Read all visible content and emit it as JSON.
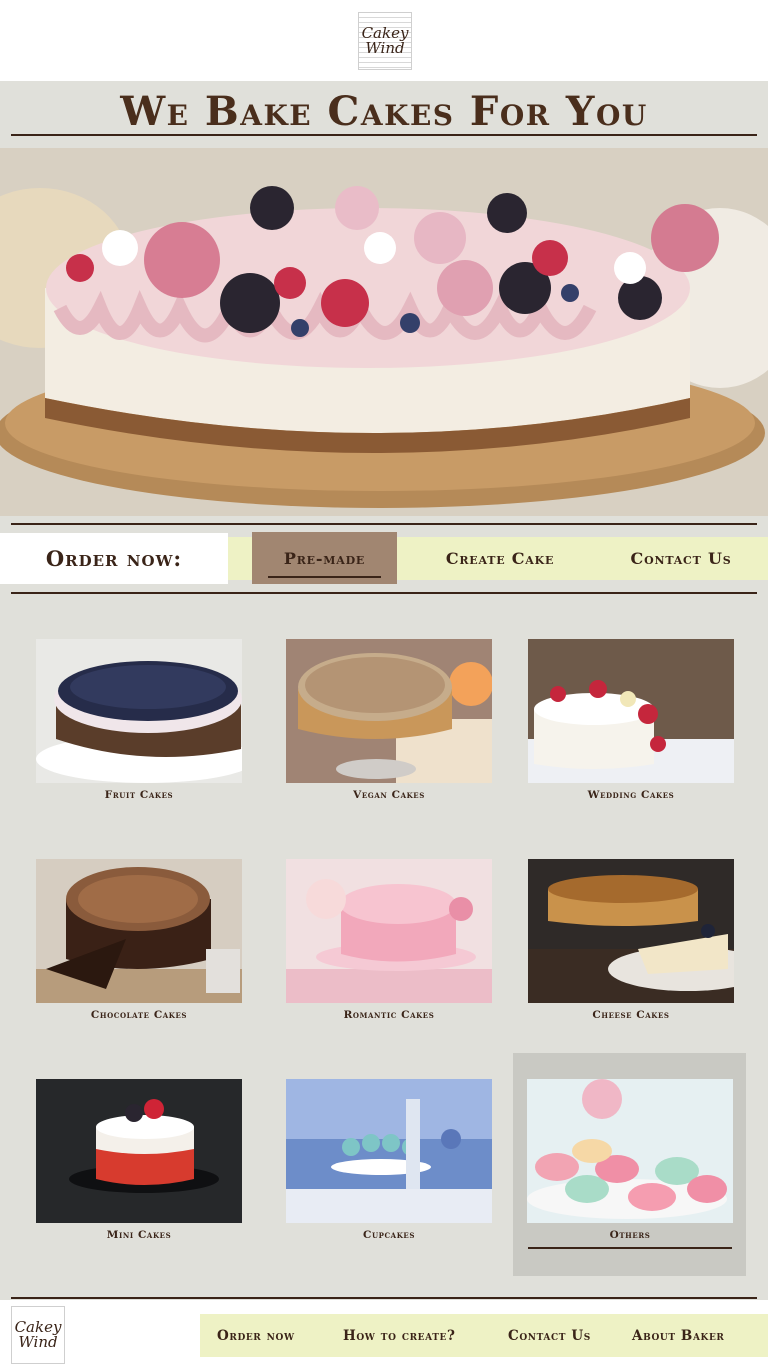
{
  "brand": {
    "logo_line1": "Cakey",
    "logo_line2": "Wind"
  },
  "hero": {
    "title": "We Bake Cakes For You"
  },
  "order_bar": {
    "label": "Order now:",
    "tabs": [
      {
        "label": "Pre-made",
        "active": true
      },
      {
        "label": "Create Cake",
        "active": false
      },
      {
        "label": "Contact Us",
        "active": false
      }
    ]
  },
  "categories": [
    {
      "label": "Fruit Cakes"
    },
    {
      "label": "Vegan Cakes"
    },
    {
      "label": "Wedding Cakes"
    },
    {
      "label": "Chocolate Cakes"
    },
    {
      "label": "Romantic Cakes"
    },
    {
      "label": "Cheese Cakes"
    },
    {
      "label": "Mini Cakes"
    },
    {
      "label": "Cupcakes"
    },
    {
      "label": "Others",
      "selected": true
    }
  ],
  "footer": {
    "nav": [
      "Order now",
      "How to create?",
      "Contact Us",
      "About Baker"
    ]
  },
  "colors": {
    "background": "#e0e0da",
    "text": "#3a2418",
    "nav_bg": "#eef2c5",
    "active_tab": "#a18671"
  }
}
